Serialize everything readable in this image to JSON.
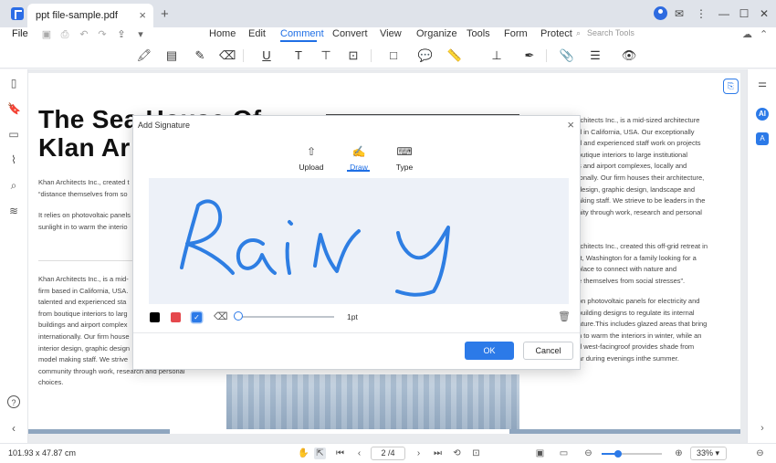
{
  "titlebar": {
    "tab_label": "ppt file-sample.pdf",
    "tab_close": "×",
    "new_tab": "+",
    "window_controls": [
      "user-avatar",
      "feedback-icon",
      "more-icon",
      "minimize-icon",
      "maximize-icon",
      "close-icon"
    ]
  },
  "menubar": {
    "file": "File",
    "items": [
      "Home",
      "Edit",
      "Comment",
      "Convert",
      "View",
      "Organize",
      "Tools",
      "Form",
      "Protect"
    ],
    "active": "Comment",
    "search_placeholder": "Search Tools"
  },
  "toolbar": {
    "tools": [
      "highlight-icon",
      "sticky-note-icon",
      "pencil-icon",
      "eraser-icon",
      "underline-icon",
      "text-icon",
      "textbox-icon",
      "callout-icon",
      "shape-icon",
      "comment-icon",
      "measure-icon",
      "stamp-icon",
      "signature-pen-icon",
      "attachment-icon",
      "note-list-icon",
      "eye-icon"
    ]
  },
  "document": {
    "title_line1": "The Sea House Of",
    "title_line2": "Klan Ar",
    "left_paragraph1": [
      "Khan Architects Inc., created t",
      "“distance themselves from so"
    ],
    "left_paragraph2": [
      "It relies on photovoltaic panels",
      "sunlight in to warm the interio"
    ],
    "left_paragraph3": [
      "Khan Architects Inc., is a mid-",
      "firm based in California, USA.",
      "talented and experienced sta",
      "from boutique interiors to larg",
      "buildings and airport complex",
      "internationally. Our firm house",
      "interior design, graphic design",
      "model making staff. We strive",
      "community through work, research and personal",
      "choices."
    ],
    "right_paragraph1": [
      "rchitects Inc., is a mid-sized architecture",
      "d in California, USA. Our exceptionally",
      "d and experienced staff work on projects",
      "outique interiors to large institutional",
      "s and airport complexes, locally and",
      "ionally. Our firm houses their architecture,",
      "design, graphic design, landscape and",
      "aking staff. We strieve to be leaders in the",
      "nity through work, research and personal"
    ],
    "right_paragraph2": [
      "rchitects Inc., created this off-grid retreat in",
      "rt, Washington for a family looking for a",
      "place to connect with nature and",
      "e themselves from social stresses”."
    ],
    "right_paragraph3": [
      "on photovoltaic panels for electricity and",
      "building designs to regulate its internal",
      "ature.This includes glazed areas that bring",
      "n to warm the interiors in winter, while an",
      "d west-facingroof provides shade from",
      "ar during evenings inthe summer."
    ]
  },
  "statusbar": {
    "page_size": "101.93 x 47.87 cm",
    "page_indicator": "2 /4",
    "zoom": "33%",
    "zoom_level": 0.27
  },
  "dialog": {
    "title": "Add Signature",
    "close": "×",
    "tabs": [
      {
        "label": "Upload",
        "icon": "upload-icon"
      },
      {
        "label": "Draw",
        "icon": "draw-icon"
      },
      {
        "label": "Type",
        "icon": "keyboard-icon"
      }
    ],
    "active_tab": "Draw",
    "signature_text": "Rainy",
    "colors": [
      "#000000",
      "#e5484d",
      "#2c7ae8"
    ],
    "selected_color": "#2c7ae8",
    "thickness": "1pt",
    "ok_label": "OK",
    "cancel_label": "Cancel"
  }
}
